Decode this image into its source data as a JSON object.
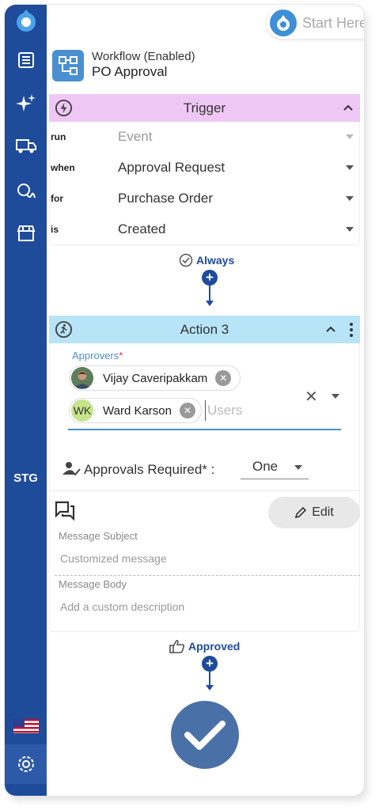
{
  "rail": {
    "env_label": "STG",
    "icons": [
      "droplet-logo-icon",
      "list-icon",
      "sparkles-icon",
      "truck-icon",
      "signature-icon",
      "store-icon",
      "us-flag-icon",
      "settings-gear-icon"
    ]
  },
  "header": {
    "start_here_label": "Start Here"
  },
  "workflow": {
    "status": "Workflow (Enabled)",
    "name": "PO Approval"
  },
  "trigger": {
    "title": "Trigger",
    "rows": [
      {
        "key": "run",
        "value": "Event",
        "muted": true
      },
      {
        "key": "when",
        "value": "Approval Request",
        "muted": false
      },
      {
        "key": "for",
        "value": "Purchase Order",
        "muted": false
      },
      {
        "key": "is",
        "value": "Created",
        "muted": false
      }
    ]
  },
  "connector1": {
    "label": "Always",
    "plus": "+"
  },
  "action": {
    "title": "Action 3",
    "approvers_label": "Approvers",
    "required_mark": "*",
    "approvers": [
      {
        "name": "Vijay Caveripakkam",
        "initials": ""
      },
      {
        "name": "Ward Karson",
        "initials": "WK"
      }
    ],
    "users_placeholder": "Users",
    "clear_glyph": "✕",
    "approvals_required_label": "Approvals Required* :",
    "approvals_required_value": "One",
    "edit_label": "Edit",
    "message_subject_label": "Message Subject",
    "message_subject_value": "Customized message",
    "message_body_label": "Message Body",
    "message_body_value": "Add a custom description"
  },
  "connector2": {
    "label": "Approved",
    "plus": "+"
  },
  "colors": {
    "rail": "#1e4b9a",
    "trigger_header": "#efc7f5",
    "action_header": "#b8e4f7",
    "accent": "#4a90d0",
    "done": "#4a70a8"
  }
}
